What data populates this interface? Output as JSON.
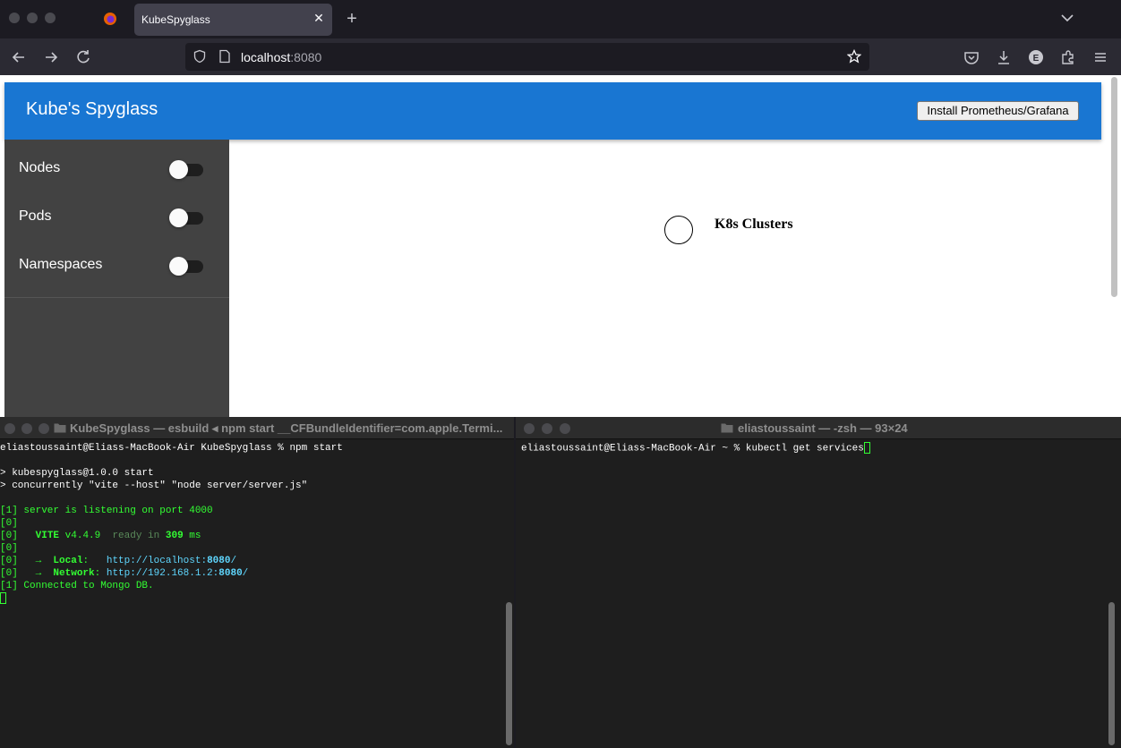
{
  "browser": {
    "tab_title": "KubeSpyglass",
    "url_host": "localhost",
    "url_port": ":8080"
  },
  "app": {
    "title": "Kube's Spyglass",
    "install_button": "Install Prometheus/Grafana",
    "sidebar": [
      {
        "label": "Nodes",
        "enabled": false
      },
      {
        "label": "Pods",
        "enabled": false
      },
      {
        "label": "Namespaces",
        "enabled": false
      }
    ],
    "cluster_label": "K8s Clusters"
  },
  "terminal_left": {
    "title": "KubeSpyglass — esbuild ◂ npm start __CFBundleIdentifier=com.apple.Termi...",
    "lines": {
      "l1": "eliastoussaint@Eliass-MacBook-Air KubeSpyglass % npm start",
      "l2": "> kubespyglass@1.0.0 start",
      "l3": "> concurrently \"vite --host\" \"node server/server.js\"",
      "l4": "[1] server is listening on port 4000",
      "l5_prefix": "[0]",
      "l6_vite": "VITE",
      "l6_version": "v4.4.9",
      "l6_ready": "ready in",
      "l6_ms_value": "309",
      "l6_ms": "ms",
      "l8_local_label": "Local",
      "l8_local_url": "http://localhost:",
      "l8_local_port": "8080",
      "l9_network_label": "Network",
      "l9_network_url": "http://192.168.1.2:",
      "l9_network_port": "8080",
      "l10": "[1] Connected to Mongo DB."
    }
  },
  "terminal_right": {
    "title": "eliastoussaint — -zsh — 93×24",
    "prompt": "eliastoussaint@Eliass-MacBook-Air ~ % kubectl get services"
  }
}
